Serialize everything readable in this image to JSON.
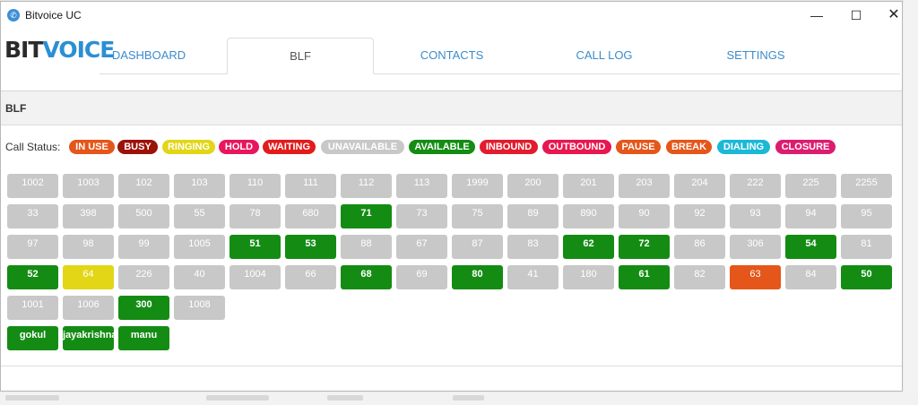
{
  "window": {
    "title": "Bitvoice UC"
  },
  "logo": {
    "part1": "BIT",
    "part2": "VOICE"
  },
  "tabs": [
    {
      "label": "DASHBOARD",
      "active": false
    },
    {
      "label": "BLF",
      "active": true
    },
    {
      "label": "CONTACTS",
      "active": false
    },
    {
      "label": "CALL LOG",
      "active": false
    },
    {
      "label": "SETTINGS",
      "active": false
    }
  ],
  "panel": {
    "title": "BLF"
  },
  "call_status_label": "Call Status:",
  "statuses": [
    {
      "label": "IN USE",
      "color": "#e4561a"
    },
    {
      "label": "BUSY",
      "color": "#9b1208"
    },
    {
      "label": "RINGING",
      "color": "#e2d616"
    },
    {
      "label": "HOLD",
      "color": "#e8175d"
    },
    {
      "label": "WAITING",
      "color": "#e21c1c"
    },
    {
      "label": "UNAVAILABLE",
      "color": "#c8c8c8"
    },
    {
      "label": "AVAILABLE",
      "color": "#148c14"
    },
    {
      "label": "INBOUND",
      "color": "#e21c2f"
    },
    {
      "label": "OUTBOUND",
      "color": "#e8174f"
    },
    {
      "label": "PAUSE",
      "color": "#e4561a"
    },
    {
      "label": "BREAK",
      "color": "#e4561a"
    },
    {
      "label": "DIALING",
      "color": "#1cb8d6"
    },
    {
      "label": "CLOSURE",
      "color": "#dc1c6f"
    }
  ],
  "extensions": [
    [
      "1002",
      "1003",
      "102",
      "103",
      "110",
      "111",
      "112",
      "113",
      "1999",
      "200",
      "201",
      "203",
      "204",
      "222",
      "225",
      "2255"
    ],
    [
      "33",
      "398",
      "500",
      "55",
      "78",
      "680",
      "71",
      "73",
      "75",
      "89",
      "890",
      "90",
      "92",
      "93",
      "94",
      "95"
    ],
    [
      "97",
      "98",
      "99",
      "1005",
      "51",
      "53",
      "88",
      "67",
      "87",
      "83",
      "62",
      "72",
      "86",
      "306",
      "54",
      "81"
    ],
    [
      "52",
      "64",
      "226",
      "40",
      "1004",
      "66",
      "68",
      "69",
      "80",
      "41",
      "180",
      "61",
      "82",
      "63",
      "84",
      "50"
    ],
    [
      "1001",
      "1006",
      "300",
      "1008"
    ],
    [
      "gokul",
      "jayakrishna",
      "manu"
    ]
  ],
  "extension_status": {
    "71": "available",
    "51": "available",
    "53": "available",
    "62": "available",
    "72": "available",
    "54": "available",
    "52": "available",
    "68": "available",
    "80": "available",
    "61": "available",
    "50": "available",
    "300": "available",
    "gokul": "available",
    "jayakrishna": "available",
    "manu": "available",
    "64": "ringing",
    "63": "pause"
  }
}
